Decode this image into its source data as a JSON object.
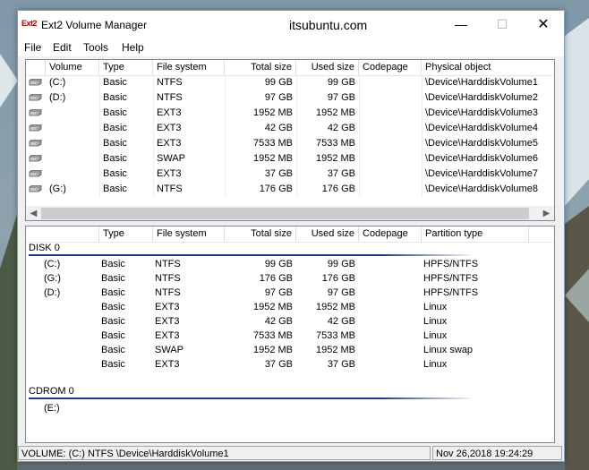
{
  "window": {
    "title": "Ext2 Volume Manager",
    "icon_text": "Ext2",
    "watermark": "itsubuntu.com",
    "controls": {
      "minimize": "—",
      "maximize": "☐",
      "close": "✕"
    }
  },
  "menu": [
    "File",
    "Edit",
    "Tools",
    "Help"
  ],
  "volumes": {
    "columns": [
      "Volume",
      "Type",
      "File system",
      "Total size",
      "Used size",
      "Codepage",
      "Physical object"
    ],
    "rows": [
      {
        "volume": "(C:)",
        "type": "Basic",
        "fs": "NTFS",
        "total": "99 GB",
        "used": "99 GB",
        "codepage": "",
        "physical": "\\Device\\HarddiskVolume1"
      },
      {
        "volume": "(D:)",
        "type": "Basic",
        "fs": "NTFS",
        "total": "97 GB",
        "used": "97 GB",
        "codepage": "",
        "physical": "\\Device\\HarddiskVolume2"
      },
      {
        "volume": "",
        "type": "Basic",
        "fs": "EXT3",
        "total": "1952 MB",
        "used": "1952 MB",
        "codepage": "",
        "physical": "\\Device\\HarddiskVolume3"
      },
      {
        "volume": "",
        "type": "Basic",
        "fs": "EXT3",
        "total": "42 GB",
        "used": "42 GB",
        "codepage": "",
        "physical": "\\Device\\HarddiskVolume4"
      },
      {
        "volume": "",
        "type": "Basic",
        "fs": "EXT3",
        "total": "7533 MB",
        "used": "7533 MB",
        "codepage": "",
        "physical": "\\Device\\HarddiskVolume5"
      },
      {
        "volume": "",
        "type": "Basic",
        "fs": "SWAP",
        "total": "1952 MB",
        "used": "1952 MB",
        "codepage": "",
        "physical": "\\Device\\HarddiskVolume6"
      },
      {
        "volume": "",
        "type": "Basic",
        "fs": "EXT3",
        "total": "37 GB",
        "used": "37 GB",
        "codepage": "",
        "physical": "\\Device\\HarddiskVolume7"
      },
      {
        "volume": "(G:)",
        "type": "Basic",
        "fs": "NTFS",
        "total": "176 GB",
        "used": "176 GB",
        "codepage": "",
        "physical": "\\Device\\HarddiskVolume8"
      }
    ],
    "scroll": {
      "left": "◀",
      "right": "▶"
    }
  },
  "disks": {
    "columns": [
      "",
      "Type",
      "File system",
      "Total size",
      "Used size",
      "Codepage",
      "Partition type"
    ],
    "disk0": {
      "label": "DISK 0",
      "rows": [
        {
          "volume": "(C:)",
          "type": "Basic",
          "fs": "NTFS",
          "total": "99 GB",
          "used": "99 GB",
          "ptype": "HPFS/NTFS"
        },
        {
          "volume": "(G:)",
          "type": "Basic",
          "fs": "NTFS",
          "total": "176 GB",
          "used": "176 GB",
          "ptype": "HPFS/NTFS"
        },
        {
          "volume": "(D:)",
          "type": "Basic",
          "fs": "NTFS",
          "total": "97 GB",
          "used": "97 GB",
          "ptype": "HPFS/NTFS"
        },
        {
          "volume": "",
          "type": "Basic",
          "fs": "EXT3",
          "total": "1952 MB",
          "used": "1952 MB",
          "ptype": "Linux"
        },
        {
          "volume": "",
          "type": "Basic",
          "fs": "EXT3",
          "total": "42 GB",
          "used": "42 GB",
          "ptype": "Linux"
        },
        {
          "volume": "",
          "type": "Basic",
          "fs": "EXT3",
          "total": "7533 MB",
          "used": "7533 MB",
          "ptype": "Linux"
        },
        {
          "volume": "",
          "type": "Basic",
          "fs": "SWAP",
          "total": "1952 MB",
          "used": "1952 MB",
          "ptype": "Linux swap"
        },
        {
          "volume": "",
          "type": "Basic",
          "fs": "EXT3",
          "total": "37 GB",
          "used": "37 GB",
          "ptype": "Linux"
        }
      ]
    },
    "cdrom0": {
      "label": "CDROM 0",
      "rows": [
        {
          "volume": "(E:)"
        }
      ]
    }
  },
  "status": {
    "volume": "VOLUME: (C:) NTFS \\Device\\HarddiskVolume1",
    "datetime": "Nov 26,2018 19:24:29"
  },
  "colors": {
    "accent": "#7a9cc7",
    "disk_line": "#1f3c88",
    "desktop": "#6f8390"
  },
  "icons": {
    "drive": "hard-drive-icon",
    "app": "ext2-app-icon"
  }
}
